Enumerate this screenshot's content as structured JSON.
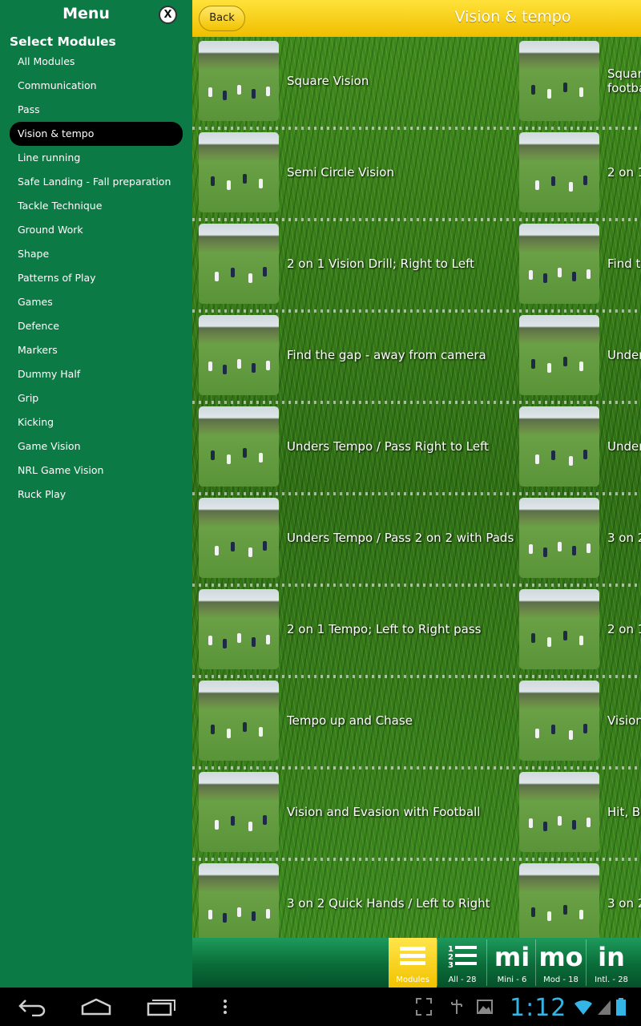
{
  "sidebar": {
    "title": "Menu",
    "close_label": "X",
    "section_label": "Select Modules",
    "modules": [
      {
        "label": "All Modules"
      },
      {
        "label": "Communication"
      },
      {
        "label": "Pass"
      },
      {
        "label": "Vision & tempo",
        "selected": true
      },
      {
        "label": "Line running"
      },
      {
        "label": "Safe Landing - Fall preparation"
      },
      {
        "label": "Tackle Technique"
      },
      {
        "label": "Ground Work"
      },
      {
        "label": "Shape"
      },
      {
        "label": "Patterns of Play"
      },
      {
        "label": "Games"
      },
      {
        "label": "Defence"
      },
      {
        "label": "Markers"
      },
      {
        "label": "Dummy Half"
      },
      {
        "label": "Grip"
      },
      {
        "label": "Kicking"
      },
      {
        "label": "Game Vision"
      },
      {
        "label": "NRL Game Vision"
      },
      {
        "label": "Ruck Play"
      }
    ]
  },
  "header": {
    "back_label": "Back",
    "title": "Vision & tempo"
  },
  "drills": {
    "left": [
      "Square Vision",
      "Semi Circle Vision",
      "2 on 1 Vision Drill; Right to Left",
      "Find the gap - away from camera",
      "Unders Tempo / Pass Right to Left",
      "Unders Tempo / Pass 2 on 2 with Pads",
      "2 on 1 Tempo;  Left to Right pass",
      "Tempo up and Chase",
      "Vision and Evasion with Football",
      "3 on 2 Quick Hands / Left to Right"
    ],
    "right": [
      "Squar",
      "2 on 1",
      "Find th",
      "Under",
      "Under",
      "3 on 2",
      "2 on 1",
      "Vision",
      "Hit, Bu",
      "3 on 2"
    ],
    "right_first_line2": "footba"
  },
  "tabbar": {
    "tabs": [
      {
        "glyph": "≡",
        "label": "Modules",
        "active": true,
        "icon": "hamburger-icon"
      },
      {
        "glyph": "1≡",
        "label": "All - 28",
        "icon": "numbered-list-icon"
      },
      {
        "glyph": "mi",
        "label": "Mini - 6"
      },
      {
        "glyph": "mo",
        "label": "Mod - 18"
      },
      {
        "glyph": "in",
        "label": "Intl. - 28"
      }
    ]
  },
  "system": {
    "clock": "1:12",
    "icons": [
      "back-icon",
      "home-icon",
      "recents-icon",
      "overflow-icon",
      "fullscreen-icon",
      "usb-icon",
      "gallery-icon",
      "wifi-icon",
      "signal-icon",
      "battery-icon"
    ]
  }
}
